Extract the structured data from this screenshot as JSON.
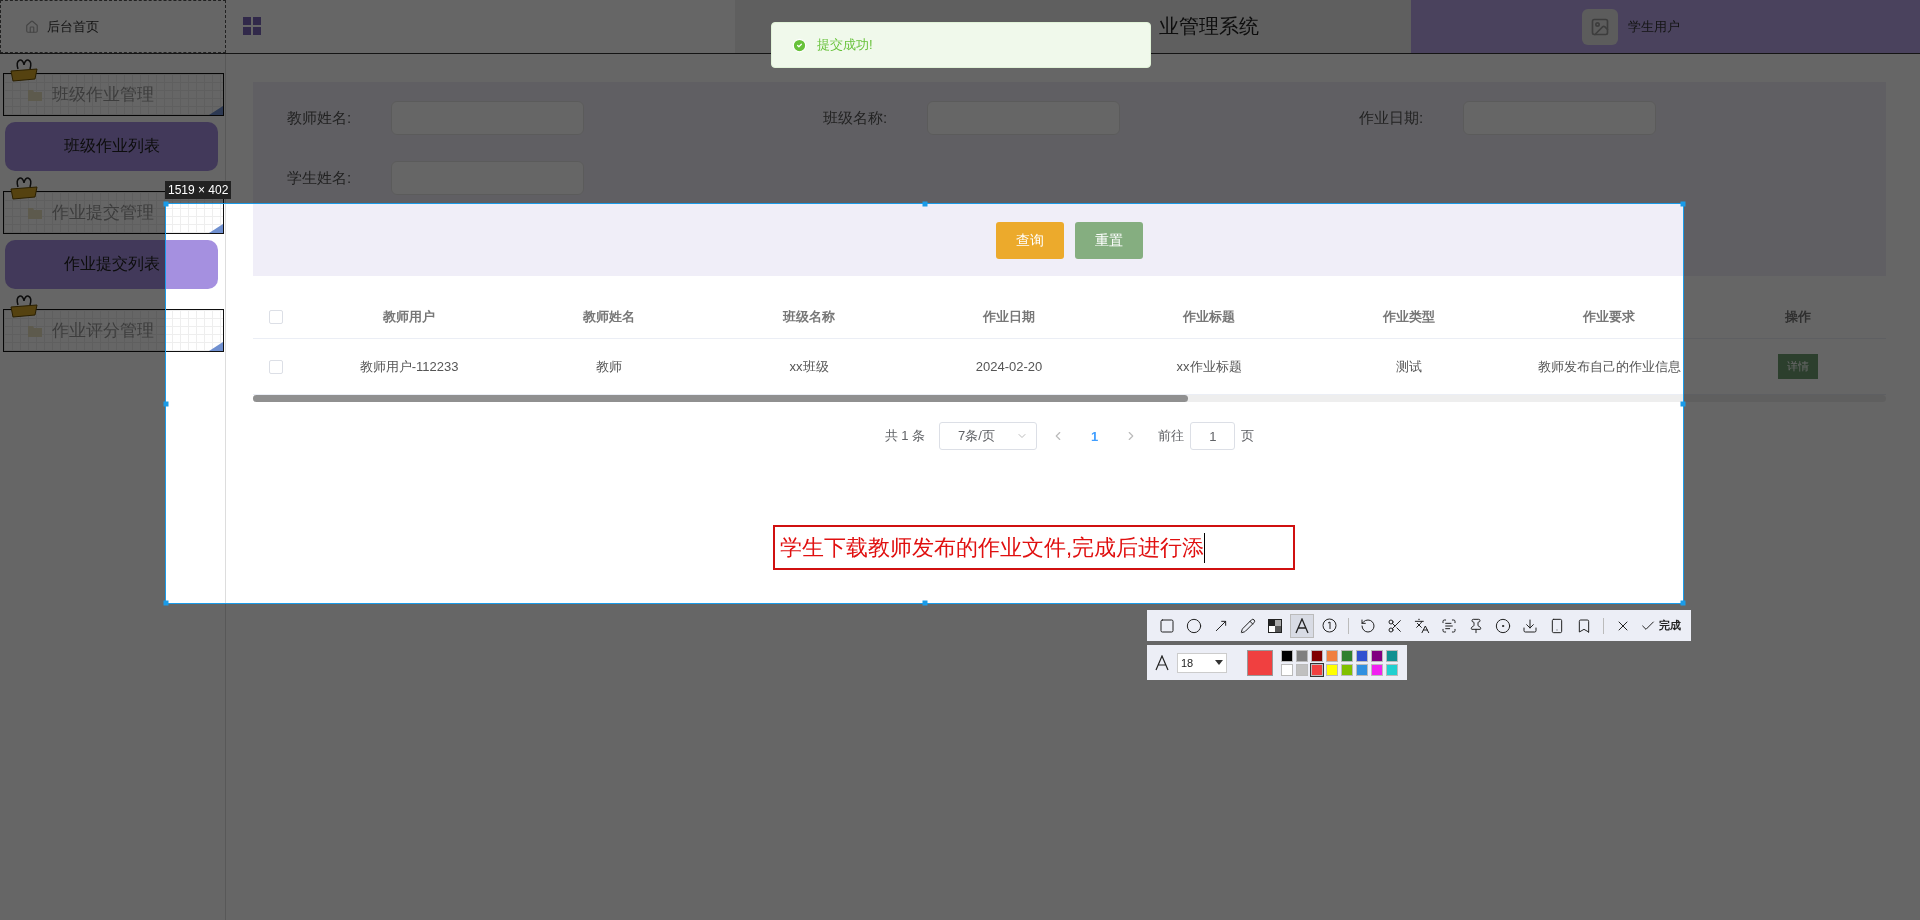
{
  "header": {
    "home": "后台首页",
    "title": "业管理系统",
    "user": "学生用户"
  },
  "toast": {
    "message": "提交成功!"
  },
  "sidebar": {
    "groups": [
      {
        "title": "班级作业管理",
        "items": [
          {
            "label": "班级作业列表"
          }
        ]
      },
      {
        "title": "作业提交管理",
        "items": [
          {
            "label": "作业提交列表"
          }
        ]
      },
      {
        "title": "作业评分管理"
      }
    ]
  },
  "search": {
    "fields": [
      {
        "label": "教师姓名:"
      },
      {
        "label": "班级名称:"
      },
      {
        "label": "作业日期:"
      },
      {
        "label": "学生姓名:"
      }
    ],
    "buttons": [
      {
        "label": "查询",
        "kind": "primary"
      },
      {
        "label": "重置",
        "kind": "reset"
      }
    ]
  },
  "table": {
    "header_checked": false,
    "columns": [
      "教师用户",
      "教师姓名",
      "班级名称",
      "作业日期",
      "作业标题",
      "作业类型",
      "作业要求",
      "操作"
    ],
    "rows": [
      {
        "checked": false,
        "cells": [
          "教师用户-112233",
          "教师",
          "xx班级",
          "2024-02-20",
          "xx作业标题",
          "测试",
          "教师发布自己的作业信息"
        ],
        "action": "详情"
      }
    ]
  },
  "pagination": {
    "total": "共 1 条",
    "page_size": "7条/页",
    "pages": [
      {
        "label": "1",
        "selected": true
      }
    ],
    "goto_label": "前往",
    "goto_value": "1",
    "goto_suffix": "页"
  },
  "capture": {
    "size": "1519 × 402",
    "annotation": "学生下载教师发布的作业文件,完成后进行添",
    "tool_groups": [
      {
        "tools": [
          {
            "kind": "rectangle",
            "selected": false
          },
          {
            "kind": "ellipse",
            "selected": false
          },
          {
            "kind": "arrow",
            "selected": false
          },
          {
            "kind": "pen",
            "selected": false
          },
          {
            "kind": "mosaic",
            "selected": false
          },
          {
            "kind": "text",
            "selected": true
          },
          {
            "kind": "number",
            "selected": false
          }
        ]
      },
      {
        "tools": [
          {
            "kind": "undo",
            "selected": false
          },
          {
            "kind": "cut",
            "selected": false
          },
          {
            "kind": "translate",
            "selected": false
          },
          {
            "kind": "scan",
            "selected": false
          },
          {
            "kind": "pin",
            "selected": false
          },
          {
            "kind": "record",
            "selected": false
          },
          {
            "kind": "save",
            "selected": false
          },
          {
            "kind": "phone",
            "selected": false
          },
          {
            "kind": "bookmark",
            "selected": false
          }
        ]
      },
      {
        "tools": [
          {
            "kind": "cancel",
            "selected": false
          }
        ]
      }
    ],
    "done": "完成",
    "font_size": "18",
    "palette": [
      {
        "color": "#000000",
        "selected": false
      },
      {
        "color": "#808080",
        "selected": false
      },
      {
        "color": "#800000",
        "selected": false
      },
      {
        "color": "#f08040",
        "selected": false
      },
      {
        "color": "#308030",
        "selected": false
      },
      {
        "color": "#3050d0",
        "selected": false
      },
      {
        "color": "#800080",
        "selected": false
      },
      {
        "color": "#109090",
        "selected": false
      },
      {
        "color": "#ffffff",
        "selected": false
      },
      {
        "color": "#c0c0c0",
        "selected": false
      },
      {
        "color": "#f04040",
        "selected": true
      },
      {
        "color": "#ffff00",
        "selected": false
      },
      {
        "color": "#80c000",
        "selected": false
      },
      {
        "color": "#3090e0",
        "selected": false
      },
      {
        "color": "#f020f0",
        "selected": false
      },
      {
        "color": "#20d0d0",
        "selected": false
      }
    ]
  }
}
